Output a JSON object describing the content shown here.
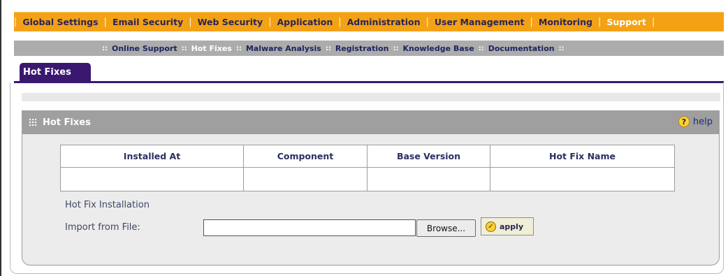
{
  "top_nav": {
    "items": [
      {
        "label": "Global Settings"
      },
      {
        "label": "Email Security"
      },
      {
        "label": "Web Security"
      },
      {
        "label": "Application"
      },
      {
        "label": "Administration"
      },
      {
        "label": "User Management"
      },
      {
        "label": "Monitoring"
      },
      {
        "label": "Support"
      }
    ],
    "active": "Support"
  },
  "sub_nav": {
    "items": [
      {
        "label": "Online Support"
      },
      {
        "label": "Hot Fixes"
      },
      {
        "label": "Malware Analysis"
      },
      {
        "label": "Registration"
      },
      {
        "label": "Knowledge Base"
      },
      {
        "label": "Documentation"
      }
    ],
    "separator": "::",
    "active": "Hot Fixes"
  },
  "tab": {
    "label": "Hot Fixes"
  },
  "panel": {
    "title": "Hot Fixes",
    "help_label": "help",
    "help_icon": "question-icon",
    "grip_icon": "grip-icon"
  },
  "table": {
    "columns": [
      "Installed At",
      "Component",
      "Base Version",
      "Hot Fix Name"
    ],
    "rows": [
      [
        "",
        "",
        "",
        ""
      ]
    ]
  },
  "install": {
    "section_label": "Hot Fix Installation",
    "import_label": "Import from File:",
    "file_value": "",
    "browse_label": "Browse...",
    "apply_label": "apply",
    "apply_icon": "check-icon"
  },
  "colors": {
    "top_nav_bg": "#f3a215",
    "sub_nav_bg": "#acacac",
    "tab_bg": "#3a1870",
    "panel_header_bg": "#9f9f9f"
  }
}
